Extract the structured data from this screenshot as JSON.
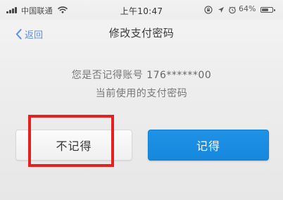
{
  "status_bar": {
    "carrier": "中国联通",
    "time": "上午10:47",
    "battery_percent": "64%",
    "battery_level": 0.64
  },
  "nav": {
    "back_label": "返回",
    "title": "修改支付密码"
  },
  "prompt": {
    "line1_prefix": "您是否记得账号",
    "account": "176******00",
    "line2": "当前使用的支付密码"
  },
  "buttons": {
    "forgot_label": "不记得",
    "remember_label": "记得"
  },
  "icons": {
    "signal": "signal-icon",
    "wifi": "wifi-icon",
    "lock": "lock-rotation-icon",
    "location": "location-arrow-icon",
    "alarm": "alarm-clock-icon",
    "battery": "battery-icon",
    "back": "chevron-left-icon"
  },
  "colors": {
    "primary": "#1688de",
    "link": "#5f90da",
    "highlight": "#e5201f"
  }
}
